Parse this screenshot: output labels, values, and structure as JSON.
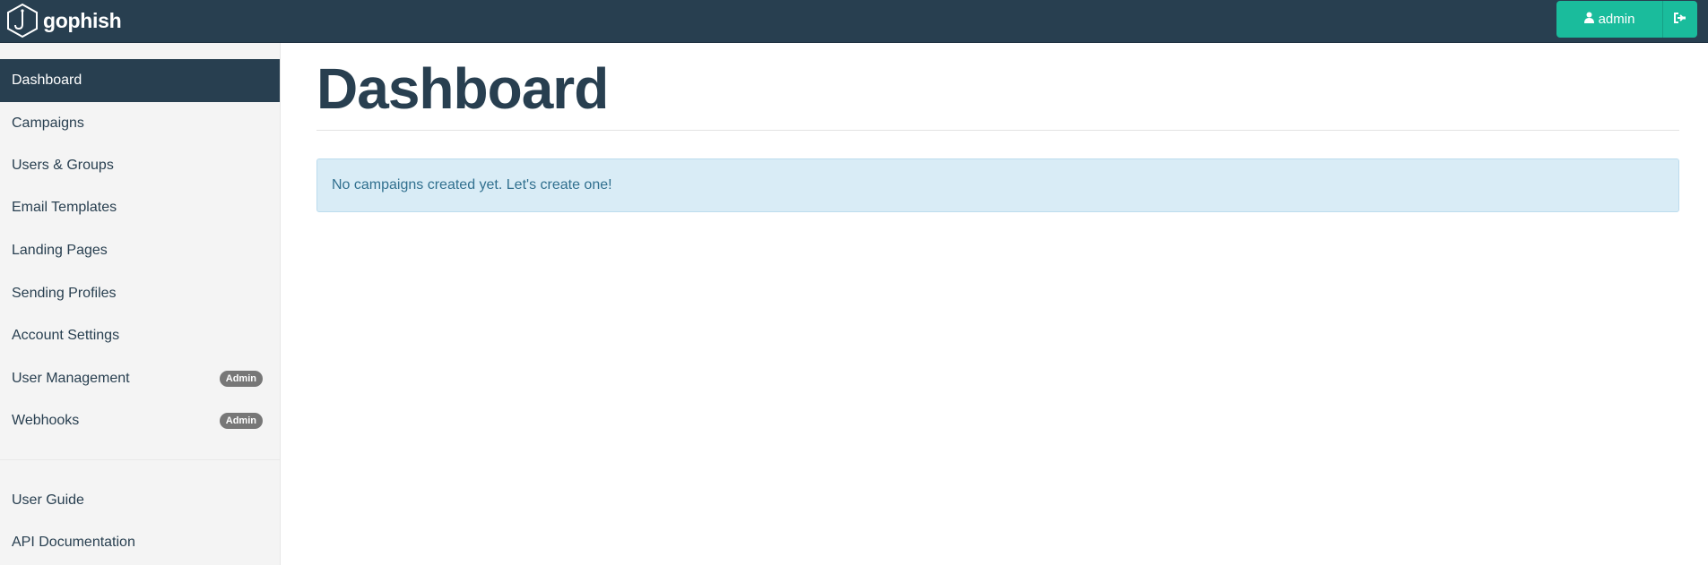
{
  "navbar": {
    "brand": "gophish",
    "logo_icon": "gophish-hook-hexagon-icon",
    "user_label": "admin",
    "user_icon": "user-icon",
    "logout_icon": "sign-out-icon"
  },
  "sidebar": {
    "items": [
      {
        "label": "Dashboard",
        "active": true
      },
      {
        "label": "Campaigns"
      },
      {
        "label": "Users & Groups"
      },
      {
        "label": "Email Templates"
      },
      {
        "label": "Landing Pages"
      },
      {
        "label": "Sending Profiles"
      },
      {
        "label": "Account Settings"
      },
      {
        "label": "User Management",
        "badge": "Admin"
      },
      {
        "label": "Webhooks",
        "badge": "Admin"
      }
    ],
    "footer_items": [
      {
        "label": "User Guide"
      },
      {
        "label": "API Documentation"
      }
    ]
  },
  "main": {
    "title": "Dashboard",
    "alert": "No campaigns created yet. Let's create one!"
  },
  "colors": {
    "navbar_bg": "#283f50",
    "accent": "#1abc9c",
    "alert_bg": "#d9ecf6",
    "alert_text": "#31708f"
  }
}
